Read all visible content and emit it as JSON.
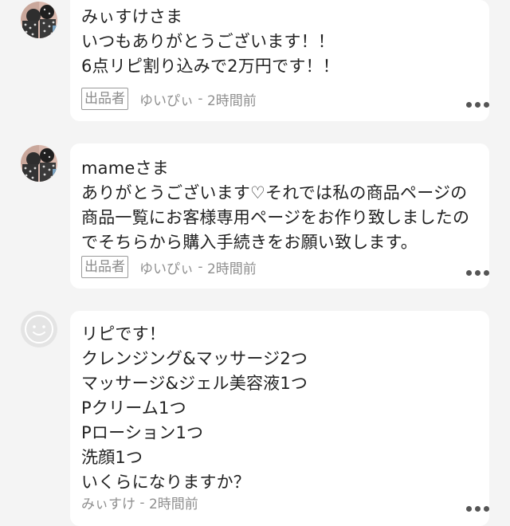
{
  "comments": [
    {
      "salutation": "みぃすけさま",
      "body": "いつもありがとうございます！！\n6点リピ割り込みで2万円です！！",
      "seller_badge": "出品者",
      "author": "ゆいぴぃ",
      "time": "2時間前"
    },
    {
      "salutation": "mameさま",
      "body": "ありがとうございます♡それでは私の商品ページの商品一覧にお客様専用ページをお作り致しましたのでそちらから購入手続きをお願い致します。",
      "seller_badge": "出品者",
      "author": "ゆいぴぃ",
      "time": "2時間前"
    },
    {
      "body": "リピです！\nクレンジング&マッサージ2つ\nマッサージ&ジェル美容液1つ\nPクリーム1つ\nPローション1つ\n洗顔1つ\nいくらになりますか？",
      "author": "みぃすけ",
      "time": "2時間前"
    }
  ],
  "separator": " - ",
  "icons": {
    "seller_avatar": "patterned-avatar-icon",
    "buyer_avatar": "smiley-face-icon",
    "more": "more-dots-icon"
  }
}
